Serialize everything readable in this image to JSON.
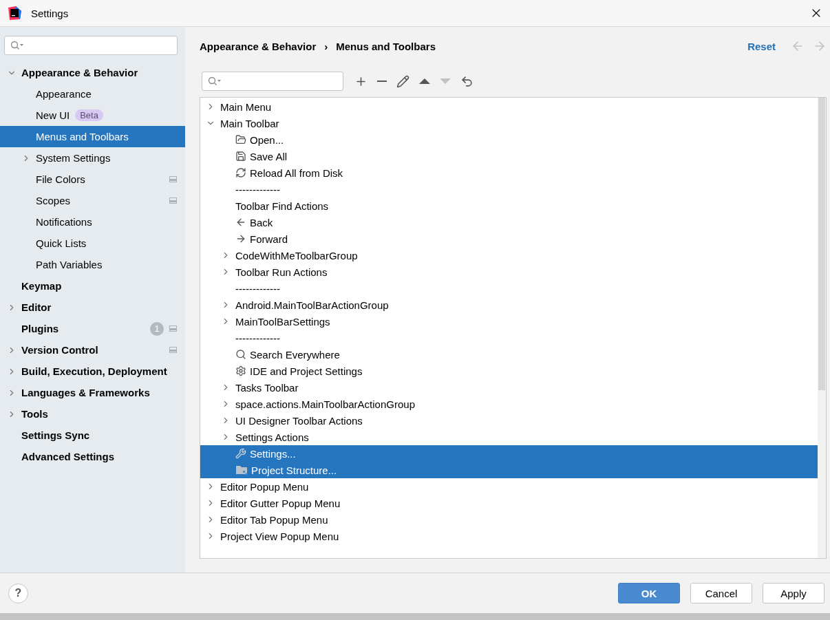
{
  "window": {
    "title": "Settings"
  },
  "sidebar": {
    "items": [
      {
        "label": "Appearance & Behavior",
        "expanded": true,
        "selected": false,
        "children": [
          {
            "label": "Appearance",
            "selected": false
          },
          {
            "label": "New UI",
            "badge": "Beta",
            "selected": false
          },
          {
            "label": "Menus and Toolbars",
            "selected": true
          },
          {
            "label": "System Settings",
            "expanded": false,
            "selected": false
          },
          {
            "label": "File Colors",
            "project_icon": true,
            "selected": false
          },
          {
            "label": "Scopes",
            "project_icon": true,
            "selected": false
          },
          {
            "label": "Notifications",
            "selected": false
          },
          {
            "label": "Quick Lists",
            "selected": false
          },
          {
            "label": "Path Variables",
            "selected": false
          }
        ]
      },
      {
        "label": "Keymap",
        "selected": false
      },
      {
        "label": "Editor",
        "expanded": false,
        "selected": false
      },
      {
        "label": "Plugins",
        "count": "1",
        "project_icon": true,
        "selected": false
      },
      {
        "label": "Version Control",
        "expanded": false,
        "project_icon": true,
        "selected": false
      },
      {
        "label": "Build, Execution, Deployment",
        "expanded": false,
        "selected": false
      },
      {
        "label": "Languages & Frameworks",
        "expanded": false,
        "selected": false
      },
      {
        "label": "Tools",
        "expanded": false,
        "selected": false
      },
      {
        "label": "Settings Sync",
        "selected": false
      },
      {
        "label": "Advanced Settings",
        "selected": false
      }
    ]
  },
  "header": {
    "breadcrumbs": [
      "Appearance & Behavior",
      "Menus and Toolbars"
    ],
    "breadcrumb_separator": "›",
    "reset": "Reset",
    "nav": [
      {
        "kind": "back",
        "disabled": true
      },
      {
        "kind": "forward",
        "disabled": true
      }
    ]
  },
  "toolbar": {
    "buttons": [
      {
        "kind": "add",
        "disabled": false
      },
      {
        "kind": "remove",
        "disabled": false
      },
      {
        "kind": "edit",
        "disabled": false
      },
      {
        "kind": "up",
        "disabled": false
      },
      {
        "kind": "down",
        "disabled": true
      },
      {
        "kind": "restore",
        "disabled": false
      }
    ]
  },
  "tree": [
    {
      "label": "Main Menu",
      "kind": "group",
      "expanded": false,
      "selected": false
    },
    {
      "label": "Main Toolbar",
      "kind": "group",
      "expanded": true,
      "selected": false,
      "children": [
        {
          "label": "Open...",
          "kind": "open",
          "selected": false
        },
        {
          "label": "Save All",
          "kind": "save",
          "selected": false
        },
        {
          "label": "Reload All from Disk",
          "kind": "reload",
          "selected": false
        },
        {
          "label": "-------------",
          "kind": "separator",
          "selected": false
        },
        {
          "label": "Toolbar Find Actions",
          "kind": "plain",
          "selected": false
        },
        {
          "label": "Back",
          "kind": "back",
          "selected": false
        },
        {
          "label": "Forward",
          "kind": "forward",
          "selected": false
        },
        {
          "label": "CodeWithMeToolbarGroup",
          "kind": "group",
          "expanded": false,
          "selected": false
        },
        {
          "label": "Toolbar Run Actions",
          "kind": "group",
          "expanded": false,
          "selected": false
        },
        {
          "label": "-------------",
          "kind": "separator",
          "selected": false
        },
        {
          "label": "Android.MainToolBarActionGroup",
          "kind": "group",
          "expanded": false,
          "selected": false
        },
        {
          "label": "MainToolBarSettings",
          "kind": "group",
          "expanded": false,
          "selected": false
        },
        {
          "label": "-------------",
          "kind": "separator",
          "selected": false
        },
        {
          "label": "Search Everywhere",
          "kind": "search",
          "selected": false
        },
        {
          "label": "IDE and Project Settings",
          "kind": "gear",
          "selected": false
        },
        {
          "label": "Tasks Toolbar",
          "kind": "group",
          "expanded": false,
          "selected": false
        },
        {
          "label": "space.actions.MainToolbarActionGroup",
          "kind": "group",
          "expanded": false,
          "selected": false
        },
        {
          "label": "UI Designer Toolbar Actions",
          "kind": "group",
          "expanded": false,
          "selected": false
        },
        {
          "label": "Settings Actions",
          "kind": "group",
          "expanded": false,
          "selected": false
        },
        {
          "label": "Settings...",
          "kind": "wrench",
          "selected": true
        },
        {
          "label": "Project Structure...",
          "kind": "structure",
          "selected": true
        }
      ]
    },
    {
      "label": "Editor Popup Menu",
      "kind": "group",
      "expanded": false,
      "selected": false
    },
    {
      "label": "Editor Gutter Popup Menu",
      "kind": "group",
      "expanded": false,
      "selected": false
    },
    {
      "label": "Editor Tab Popup Menu",
      "kind": "group",
      "expanded": false,
      "selected": false
    },
    {
      "label": "Project View Popup Menu",
      "kind": "group",
      "expanded": false,
      "selected": false
    }
  ],
  "footer": {
    "help": "?",
    "buttons": [
      {
        "label": "OK",
        "kind": "primary"
      },
      {
        "label": "Cancel",
        "kind": "default"
      },
      {
        "label": "Apply",
        "kind": "default"
      }
    ]
  }
}
